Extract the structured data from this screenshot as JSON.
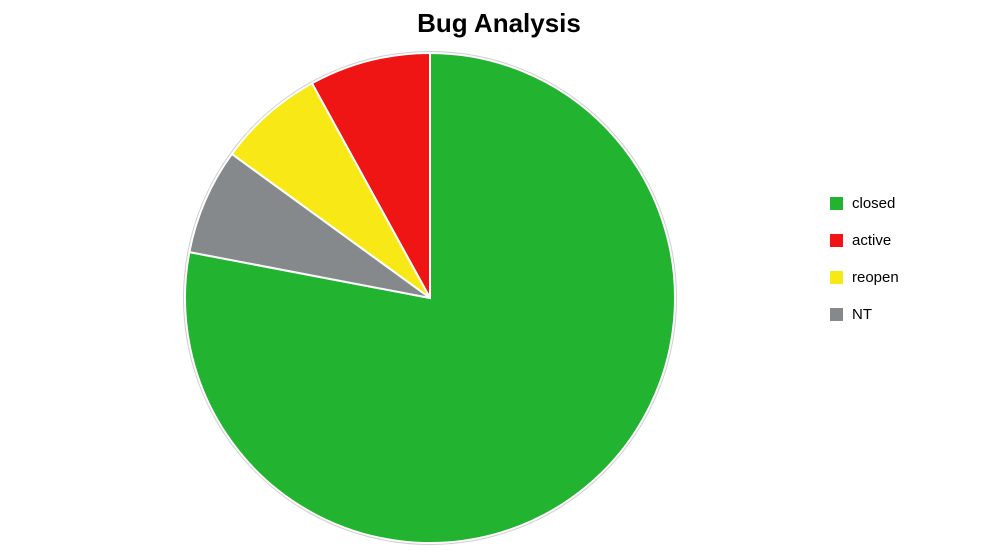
{
  "chart_data": {
    "type": "pie",
    "title": "Bug Analysis",
    "series": [
      {
        "name": "closed",
        "value": 78,
        "color": "#22b430"
      },
      {
        "name": "active",
        "value": 8,
        "color": "#ef1515"
      },
      {
        "name": "reopen",
        "value": 7,
        "color": "#f8e916"
      },
      {
        "name": "NT",
        "value": 7,
        "color": "#86898b"
      }
    ],
    "legend_position": "right"
  }
}
